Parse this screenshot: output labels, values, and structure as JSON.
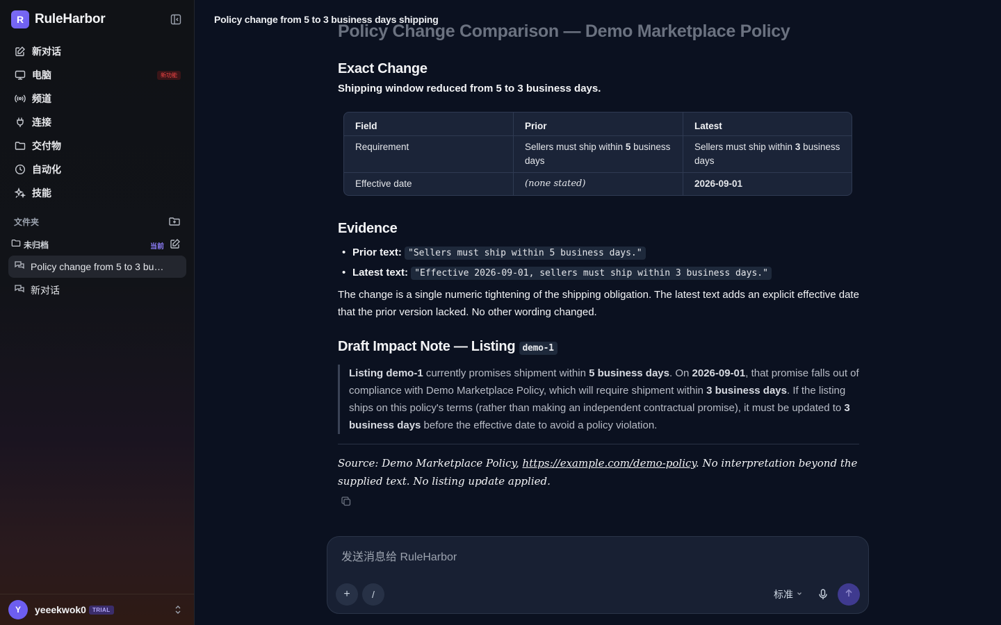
{
  "brand": {
    "logo_letter": "R",
    "name": "RuleHarbor"
  },
  "sidebar": {
    "nav": [
      {
        "label": "新对话",
        "icon": "edit-icon"
      },
      {
        "label": "电脑",
        "icon": "monitor-icon",
        "badge": "新功能"
      },
      {
        "label": "频道",
        "icon": "broadcast-icon"
      },
      {
        "label": "连接",
        "icon": "plug-icon"
      },
      {
        "label": "交付物",
        "icon": "folder-icon"
      },
      {
        "label": "自动化",
        "icon": "clock-icon"
      },
      {
        "label": "技能",
        "icon": "sparkle-icon"
      }
    ],
    "folders_label": "文件夹",
    "group": {
      "label": "未归档",
      "current": "当前"
    },
    "chats": [
      {
        "label": "Policy change from 5 to 3 business days shipping"
      },
      {
        "label": "新对话"
      }
    ],
    "user": {
      "initial": "Y",
      "name": "yeeekwok0",
      "plan": "TRIAL"
    }
  },
  "topbar": {
    "title": "Policy change from 5 to 3 business days shipping"
  },
  "doc": {
    "title": "Policy Change Comparison — Demo Marketplace Policy",
    "exact_change": {
      "heading": "Exact Change",
      "summary": "Shipping window reduced from 5 to 3 business days.",
      "table": {
        "headers": [
          "Field",
          "Prior",
          "Latest"
        ],
        "rows": [
          {
            "field": "Requirement",
            "prior_pre": "Sellers must ship within ",
            "prior_bold": "5",
            "prior_post": " business days",
            "latest_pre": "Sellers must ship within ",
            "latest_bold": "3",
            "latest_post": " business days"
          },
          {
            "field": "Effective date",
            "prior": "(none stated)",
            "latest": "2026-09-01"
          }
        ]
      }
    },
    "evidence": {
      "heading": "Evidence",
      "items": [
        {
          "label": "Prior text:",
          "code": "\"Sellers must ship within 5 business days.\""
        },
        {
          "label": "Latest text:",
          "code": "\"Effective 2026-09-01, sellers must ship within 3 business days.\""
        }
      ],
      "paragraph": "The change is a single numeric tightening of the shipping obligation. The latest text adds an explicit effective date that the prior version lacked. No other wording changed."
    },
    "impact": {
      "heading": "Draft Impact Note — Listing",
      "heading_code": "demo-1",
      "q1": "Listing demo-1",
      "q2": " currently promises shipment within ",
      "q3": "5 business days",
      "q4": ". On ",
      "q5": "2026-09-01",
      "q6": ", that promise falls out of compliance with Demo Marketplace Policy, which will require shipment within ",
      "q7": "3 business days",
      "q8": ". If the listing ships on this policy's terms (rather than making an independent contractual promise), it must be updated to ",
      "q9": "3 business days",
      "q10": " before the effective date to avoid a policy violation."
    },
    "source": {
      "pre": "Source: Demo Marketplace Policy, ",
      "link": "https://example.com/demo-policy",
      "post": ". No interpretation beyond the supplied text. No listing update applied."
    }
  },
  "composer": {
    "placeholder": "发送消息给 RuleHarbor",
    "plus": "+",
    "slash": "/",
    "mode": "标准"
  }
}
